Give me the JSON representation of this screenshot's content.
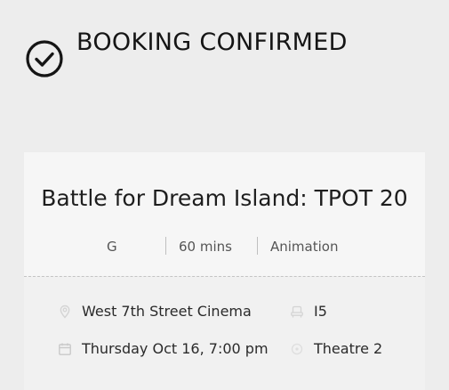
{
  "header": {
    "title": "BOOKING CONFIRMED",
    "icon": "check-circle-icon"
  },
  "movie": {
    "title": "Battle for Dream Island: TPOT 20",
    "rating": "G",
    "duration": "60 mins",
    "genre": "Animation"
  },
  "details": {
    "cinema": {
      "icon": "location-pin-icon",
      "value": "West 7th Street Cinema"
    },
    "seat": {
      "icon": "seat-icon",
      "value": "I5"
    },
    "datetime": {
      "icon": "calendar-icon",
      "value": "Thursday Oct 16, 7:00 pm"
    },
    "theatre": {
      "icon": "screen-icon",
      "value": "Theatre 2"
    }
  },
  "colors": {
    "background": "#ededed",
    "card": "#f1f1f1",
    "text": "#1a1a1a",
    "muted": "#555555",
    "icon_faint": "#d4d4d4"
  }
}
